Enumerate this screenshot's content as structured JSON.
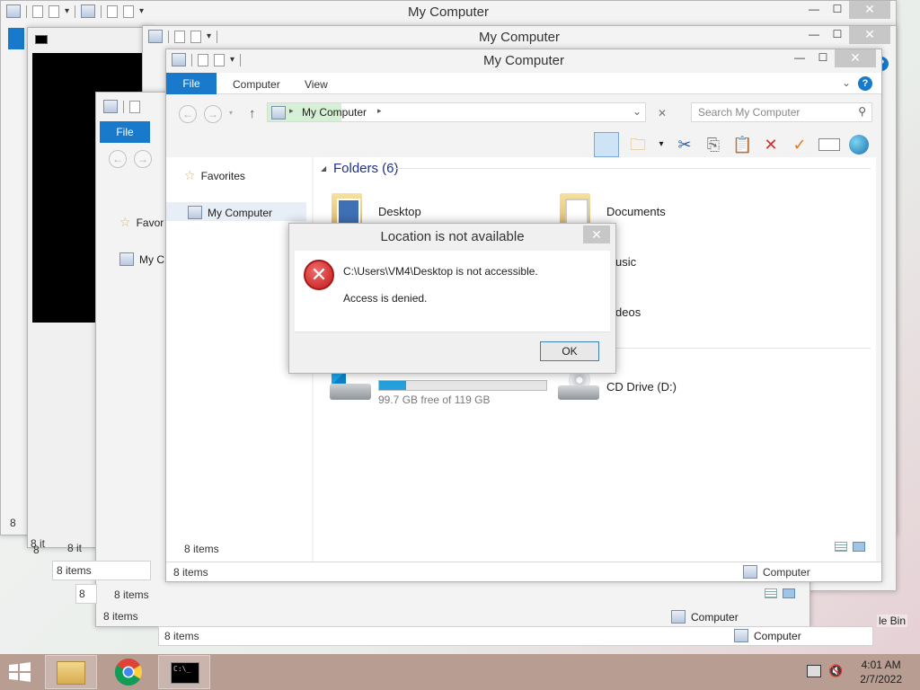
{
  "windows": {
    "back_title_1": "My Computer",
    "back_title_2": "My Computer",
    "main_title": "My Computer"
  },
  "ribbon": {
    "file": "File",
    "computer": "Computer",
    "view": "View"
  },
  "address": {
    "location": "My Computer",
    "search_placeholder": "Search My Computer"
  },
  "nav": {
    "favorites": "Favorites",
    "my_computer": "My Computer",
    "favorites_trunc": "Favor",
    "my_computer_trunc": "My C"
  },
  "content": {
    "group_folders": "Folders (6)",
    "folders": [
      "Desktop",
      "Documents",
      "usic",
      "deos"
    ],
    "drive_c_free": "99.7 GB free of 119 GB",
    "drive_c_used_fraction": 0.16,
    "drive_d": "CD Drive (D:)"
  },
  "status": {
    "items": "8 items",
    "computer": "Computer",
    "items_partial_1": "8 it",
    "items_partial_2": "8",
    "recycle": "le Bin"
  },
  "dialog": {
    "title": "Location is not available",
    "message": "C:\\Users\\VM4\\Desktop is not accessible.",
    "detail": "Access is denied.",
    "ok": "OK"
  },
  "taskbar": {
    "time": "4:01 AM",
    "date": "2/7/2022"
  },
  "colors": {
    "accent": "#1979ca",
    "taskbar": "#b89d93",
    "error": "#c11a1a"
  }
}
